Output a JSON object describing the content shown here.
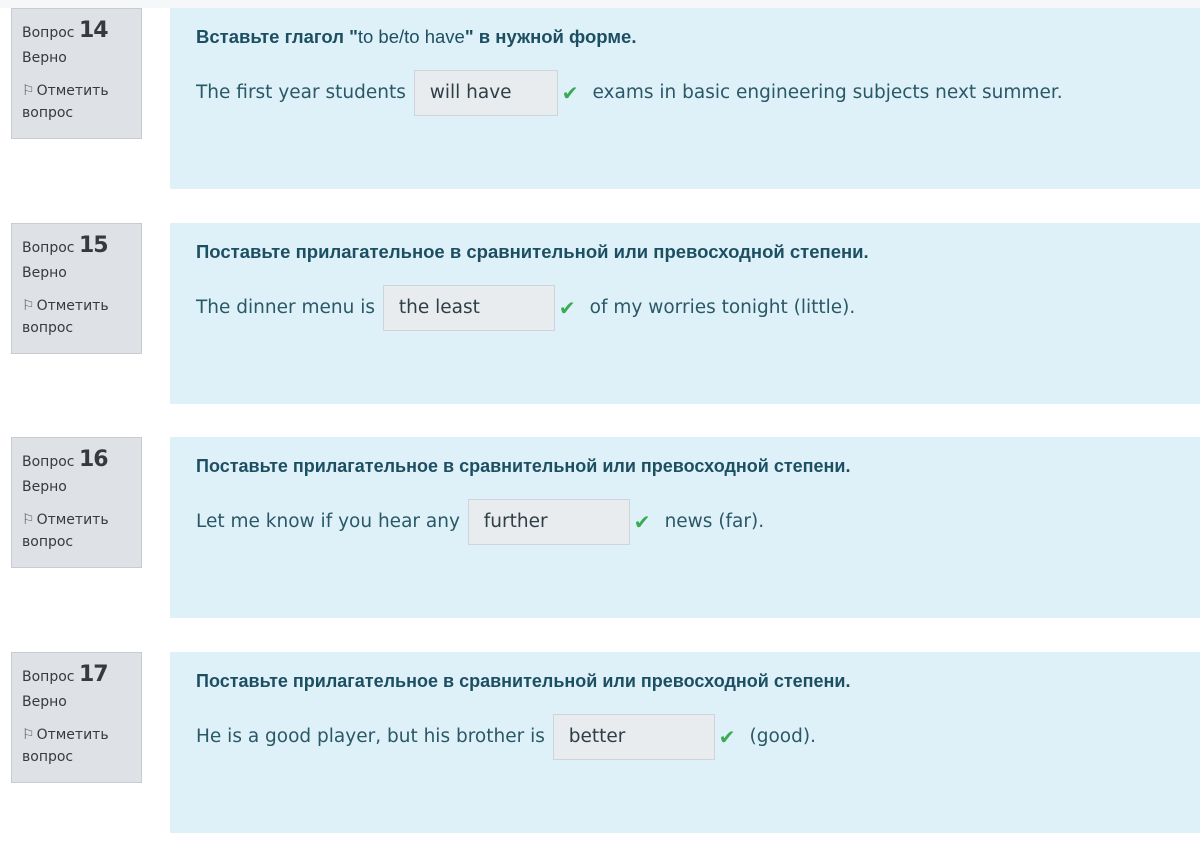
{
  "labels": {
    "question_word": "Вопрос",
    "state": "Верно",
    "flag_line1": "Отметить",
    "flag_line2": "вопрос"
  },
  "colors": {
    "panel_bg": "#def1f8",
    "info_bg": "#dee2e6",
    "check": "#3aaa55"
  },
  "questions": [
    {
      "number": "14",
      "instruction_pre": "Вставьте глагол \"",
      "instruction_mid": "to be/to have",
      "instruction_post": "\" в нужной форме.",
      "before": "The first year students",
      "answer": "will have",
      "after": "exams in basic engineering subjects next summer."
    },
    {
      "number": "15",
      "instruction": "Поставьте прилагательное в сравнительной или превосходной степени.",
      "before": "The dinner menu is",
      "answer": "the least",
      "after": "of my worries tonight (little)."
    },
    {
      "number": "16",
      "instruction": "Поставьте прилагательное в сравнительной или превосходной степени.",
      "before": "Let me know if you hear any",
      "answer": "further",
      "after": "news (far)."
    },
    {
      "number": "17",
      "instruction": "Поставьте прилагательное в сравнительной или превосходной степени.",
      "before": "He is a good player, but his brother is",
      "answer": "better",
      "after": "(good)."
    }
  ]
}
